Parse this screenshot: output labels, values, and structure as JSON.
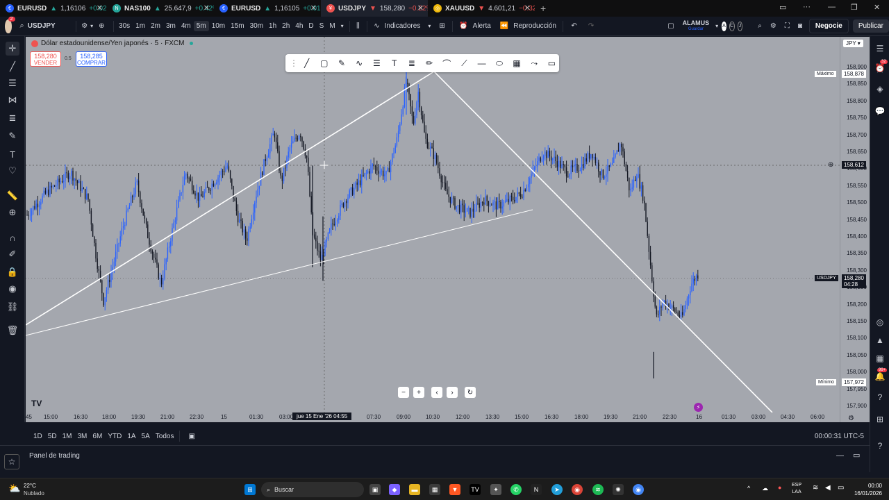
{
  "tabs": [
    {
      "symbol": "EURUSD",
      "price": "1,16106",
      "change": "+0.02%",
      "dir": "up",
      "icon_color": "#2962ff"
    },
    {
      "symbol": "NAS100",
      "price": "25.647,9",
      "change": "+0.42%",
      "dir": "up",
      "icon_color": "#26a69a"
    },
    {
      "symbol": "EURUSD",
      "price": "1,16105",
      "change": "+0.01%",
      "dir": "up",
      "icon_color": "#2962ff"
    },
    {
      "symbol": "USDJPY",
      "price": "158,280",
      "change": "−0.22%",
      "dir": "down",
      "icon_color": "#ef5350",
      "active": true
    },
    {
      "symbol": "XAUUSD",
      "price": "4.601,21",
      "change": "−0.32%",
      "dir": "down",
      "icon_color": "#f0b90b"
    }
  ],
  "toolbar": {
    "symbol": "USDJPY",
    "timeframes": [
      "30s",
      "1m",
      "2m",
      "3m",
      "4m",
      "5m",
      "10m",
      "15m",
      "30m",
      "1h",
      "2h",
      "4h",
      "D",
      "S",
      "M"
    ],
    "selected_timeframe": "5m",
    "indicators_label": "Indicadores",
    "alert_label": "Alerta",
    "replay_label": "Reproducción",
    "layout_name": "ALAMUS",
    "layout_status": "Guardar",
    "trade_label": "Negocie",
    "publish_label": "Publicar",
    "avatar_badge": "2"
  },
  "chart": {
    "title": "Dólar estadounidense/Yen japonés · 5 · FXCM",
    "sell_price": "158,280",
    "sell_label": "VENDER",
    "spread": "0.5",
    "buy_price": "158,285",
    "buy_label": "COMPRAR",
    "currency": "JPY",
    "price_ticks": [
      "158,900",
      "158,850",
      "158,800",
      "158,750",
      "158,700",
      "158,650",
      "158,600",
      "158,550",
      "158,500",
      "158,450",
      "158,400",
      "158,350",
      "158,300",
      "158,250",
      "158,200",
      "158,150",
      "158,100",
      "158,050",
      "158,000",
      "157,950",
      "157,900"
    ],
    "max_label": "Máximo",
    "max_price": "158,878",
    "min_label": "Mínimo",
    "min_price": "157,972",
    "crosshair_price": "158,612",
    "current_symbol": "USDJPY",
    "current_price": "158,280",
    "countdown": "04:28",
    "time_ticks": [
      "45",
      "15:00",
      "16:30",
      "18:00",
      "19:30",
      "21:00",
      "22:30",
      "15",
      "01:30",
      "03:00",
      "07:30",
      "09:00",
      "10:30",
      "12:00",
      "13:30",
      "15:00",
      "16:30",
      "18:00",
      "19:30",
      "21:00",
      "22:30",
      "16",
      "01:30",
      "03:00",
      "04:30",
      "06:00"
    ],
    "crosshair_time": "jue 15 Ene '26   04:55",
    "up_color": "#2962ff",
    "down_color": "#131722"
  },
  "range_bar": {
    "ranges": [
      "1D",
      "5D",
      "1M",
      "3M",
      "6M",
      "YTD",
      "1A",
      "5A",
      "Todos"
    ],
    "clock": "00:00:31 UTC-5"
  },
  "panel": {
    "label": "Panel de trading"
  },
  "right_badges": {
    "notifications": "32",
    "messages": "99+"
  },
  "taskbar": {
    "weather_temp": "22°C",
    "weather_desc": "Nublado",
    "search_placeholder": "Buscar",
    "lang": "ESP",
    "lang2": "LAA",
    "time": "00:00",
    "date": "16/01/2026"
  }
}
